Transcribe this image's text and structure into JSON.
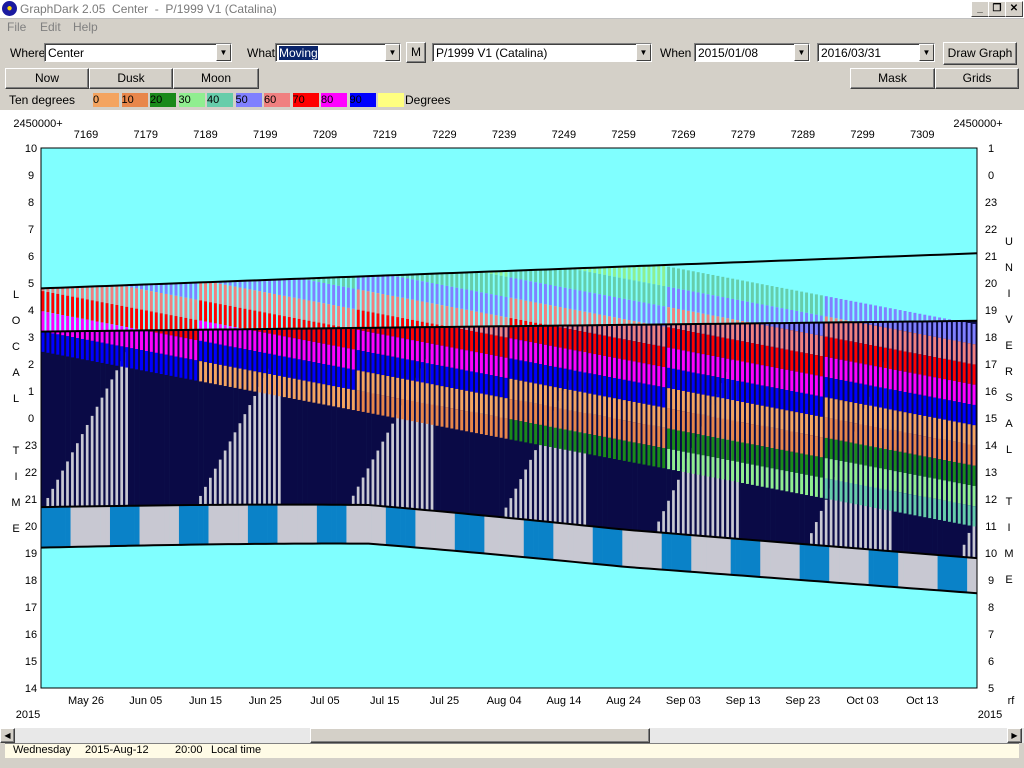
{
  "window": {
    "title": "GraphDark 2.05  Center  -  P/1999 V1 (Catalina)",
    "minimize": "_",
    "restore": "❐",
    "close": "✕"
  },
  "menu": {
    "items": [
      "File",
      "Edit",
      "Help"
    ]
  },
  "toolbar": {
    "where_label": "Where",
    "where_value": "Center",
    "what_label": "What",
    "what_value": "Moving",
    "m_button": "M",
    "object_value": "P/1999 V1 (Catalina)",
    "when_label": "When",
    "start_date": "2015/01/08",
    "end_date": "2016/03/31",
    "draw_graph": "Draw Graph"
  },
  "buttons": {
    "now": "Now",
    "dusk": "Dusk",
    "moon": "Moon",
    "mask": "Mask",
    "grids": "Grids"
  },
  "legend": {
    "title": "Ten degrees",
    "units": "Degrees",
    "entries": [
      {
        "label": "0",
        "color": "#f4a460"
      },
      {
        "label": "10",
        "color": "#e8864a"
      },
      {
        "label": "20",
        "color": "#1a8a1a"
      },
      {
        "label": "30",
        "color": "#90ee90"
      },
      {
        "label": "40",
        "color": "#66cdaa"
      },
      {
        "label": "50",
        "color": "#8080ff"
      },
      {
        "label": "60",
        "color": "#f08080"
      },
      {
        "label": "70",
        "color": "#ff0000"
      },
      {
        "label": "80",
        "color": "#ff00ff"
      },
      {
        "label": "90",
        "color": "#0000ff"
      },
      {
        "label": "",
        "color": "#ffff80"
      }
    ]
  },
  "graph": {
    "jd_prefix_left": "2450000+",
    "jd_prefix_right": "2450000+",
    "jd_ticks": [
      "7169",
      "7179",
      "7189",
      "7199",
      "7209",
      "7219",
      "7229",
      "7239",
      "7249",
      "7259",
      "7269",
      "7279",
      "7289",
      "7299",
      "7309"
    ],
    "date_ticks": [
      "May 26",
      "Jun 05",
      "Jun 15",
      "Jun 25",
      "Jul 05",
      "Jul 15",
      "Jul 25",
      "Aug 04",
      "Aug 14",
      "Aug 24",
      "Sep 03",
      "Sep 13",
      "Sep 23",
      "Oct 03",
      "Oct 13"
    ],
    "year_left": "2015",
    "year_right": "2015",
    "rf_label": "rf",
    "left_hours": [
      "10",
      "9",
      "8",
      "7",
      "6",
      "5",
      "4",
      "3",
      "2",
      "1",
      "0",
      "23",
      "22",
      "21",
      "20",
      "19",
      "18",
      "17",
      "16",
      "15",
      "14"
    ],
    "right_hours": [
      "1",
      "0",
      "23",
      "22",
      "21",
      "20",
      "19",
      "18",
      "17",
      "16",
      "15",
      "14",
      "13",
      "12",
      "11",
      "10",
      "9",
      "8",
      "7",
      "6",
      "5"
    ],
    "left_axis_title": [
      "L",
      "O",
      "C",
      "A",
      "L",
      "",
      "T",
      "I",
      "M",
      "E"
    ],
    "right_axis_title": [
      "U",
      "N",
      "I",
      "V",
      "E",
      "R",
      "S",
      "A",
      "L",
      "",
      "T",
      "I",
      "M",
      "E"
    ],
    "colors": {
      "sky": "#80ffff",
      "night": "#0a0a46",
      "twilight_gray": "#c8c8d2",
      "twilight_blue": "#0a82c8"
    }
  },
  "status": {
    "weekday": "Wednesday",
    "date": "2015-Aug-12",
    "time": "20:00",
    "zone": "Local time"
  }
}
